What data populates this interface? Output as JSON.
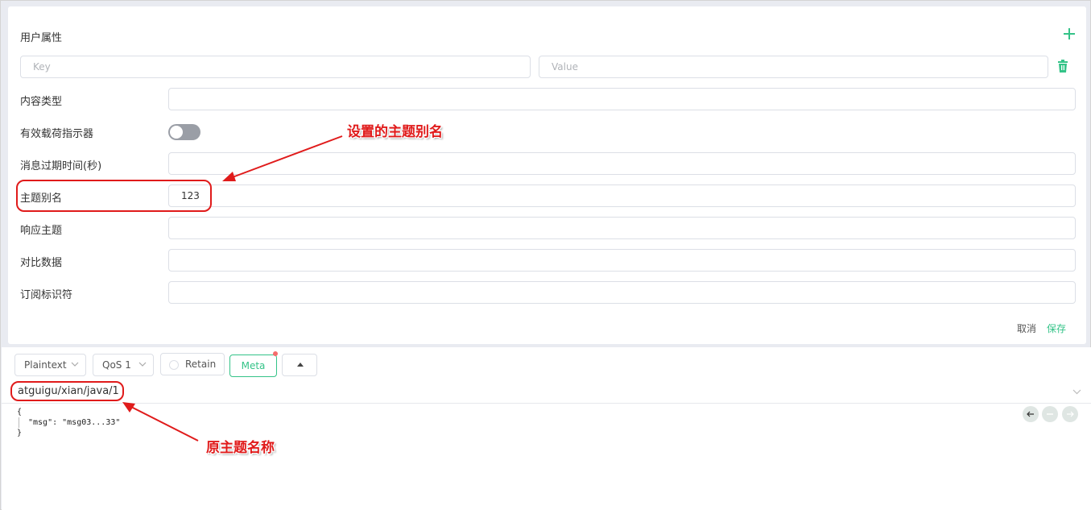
{
  "meta_panel": {
    "user_properties_label": "用户属性",
    "key_placeholder": "Key",
    "value_placeholder": "Value",
    "content_type_label": "内容类型",
    "payload_indicator_label": "有效载荷指示器",
    "message_expiry_label": "消息过期时间(秒)",
    "topic_alias_label": "主题别名",
    "topic_alias_value": "123",
    "response_topic_label": "响应主题",
    "correlation_data_label": "对比数据",
    "subscription_id_label": "订阅标识符",
    "cancel_label": "取消",
    "save_label": "保存"
  },
  "toolbar": {
    "format": "Plaintext",
    "qos": "QoS 1",
    "retain_label": "Retain",
    "meta_label": "Meta"
  },
  "message": {
    "topic": "atguigu/xian/java/1",
    "payload_line1": "{",
    "payload_line2": "\"msg\": \"msg03...33\"",
    "payload_line3": "}"
  },
  "annotations": {
    "alias_note": "设置的主题别名",
    "topic_note": "原主题名称"
  },
  "colors": {
    "accent": "#34c388",
    "annotation": "#e01b1b",
    "toggle_off": "#9a9ea6"
  },
  "icons": [
    "plus-icon",
    "trash-icon",
    "chevron-down-icon",
    "arrow-left-icon",
    "minus-icon",
    "arrow-right-icon",
    "caret-up-icon"
  ]
}
